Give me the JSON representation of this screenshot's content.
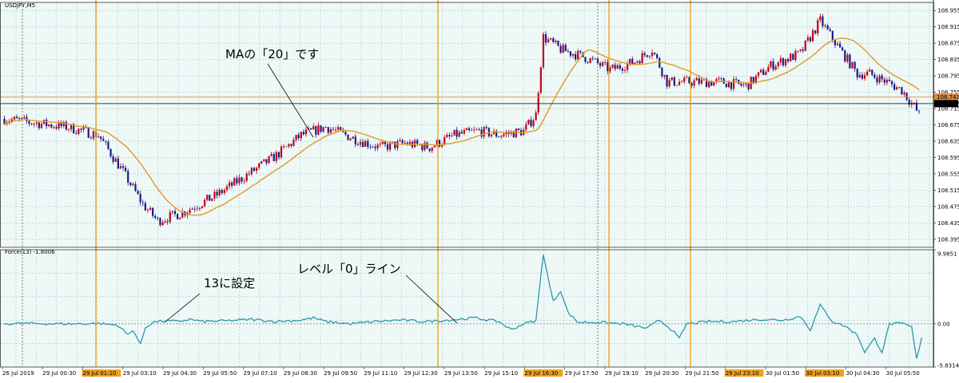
{
  "chart_data": {
    "type": "candlestick",
    "symbol_label": "USDJPY,M5",
    "indicator_label": "Force(13) -1.8006",
    "price_axis": {
      "range": [
        108.375,
        108.975
      ],
      "ticks": [
        "108.955",
        "108.915",
        "108.875",
        "108.835",
        "108.795",
        "108.755",
        "108.715",
        "108.675",
        "108.635",
        "108.595",
        "108.555",
        "108.515",
        "108.475",
        "108.435",
        "108.395"
      ]
    },
    "price_tags": [
      {
        "label": "108.743",
        "value": 108.743,
        "color": "#e08a3c"
      },
      {
        "label": "108.727",
        "value": 108.727,
        "color": "#000000"
      }
    ],
    "indicator_axis": {
      "range": [
        -5.8314,
        9.9851
      ],
      "ticks": [
        {
          "label": "9.9851",
          "value": 9.9851
        },
        {
          "label": "0.00",
          "value": 0
        },
        {
          "label": "-5.8314",
          "value": -5.8314
        }
      ]
    },
    "time_axis": {
      "labels": [
        "26 Jul 2019",
        "29 Jul 00:30",
        "29 Jul 01:10",
        "29 Jul 03:10",
        "29 Jul 04:30",
        "29 Jul 05:50",
        "29 Jul 07:10",
        "29 Jul 08:30",
        "29 Jul 09:50",
        "29 Jul 11:10",
        "29 Jul 12:30",
        "29 Jul 13:50",
        "29 Jul 15:10",
        "29 Jul 16:30",
        "29 Jul 17:50",
        "29 Jul 19:10",
        "29 Jul 20:30",
        "29 Jul 21:50",
        "29 Jul 23:10",
        "30 Jul 01:50",
        "30 Jul 03:10",
        "30 Jul 04:30",
        "30 Jul 05:50"
      ],
      "highlighted": [
        2,
        13,
        18,
        20
      ]
    },
    "ma_label": "MA",
    "series": [
      {
        "name": "USDJPY",
        "type": "candle",
        "color_up": "#c00018",
        "color_down": "#1a1a8c",
        "key_points": [
          [
            0,
            108.69
          ],
          [
            12,
            108.68
          ],
          [
            25,
            108.67
          ],
          [
            38,
            108.65
          ],
          [
            48,
            108.56
          ],
          [
            56,
            108.48
          ],
          [
            62,
            108.44
          ],
          [
            72,
            108.46
          ],
          [
            85,
            108.5
          ],
          [
            100,
            108.56
          ],
          [
            110,
            108.6
          ],
          [
            120,
            108.65
          ],
          [
            130,
            108.67
          ],
          [
            142,
            108.64
          ],
          [
            152,
            108.62
          ],
          [
            162,
            108.63
          ],
          [
            172,
            108.62
          ],
          [
            182,
            108.65
          ],
          [
            192,
            108.66
          ],
          [
            200,
            108.65
          ],
          [
            210,
            108.66
          ],
          [
            215,
            108.7
          ],
          [
            218,
            108.89
          ],
          [
            225,
            108.86
          ],
          [
            235,
            108.84
          ],
          [
            245,
            108.81
          ],
          [
            255,
            108.83
          ],
          [
            262,
            108.86
          ],
          [
            268,
            108.78
          ],
          [
            278,
            108.78
          ],
          [
            290,
            108.78
          ],
          [
            300,
            108.77
          ],
          [
            310,
            108.82
          ],
          [
            322,
            108.85
          ],
          [
            330,
            108.93
          ],
          [
            338,
            108.86
          ],
          [
            345,
            108.8
          ],
          [
            350,
            108.8
          ],
          [
            357,
            108.78
          ],
          [
            363,
            108.76
          ],
          [
            368,
            108.72
          ],
          [
            370,
            108.7
          ]
        ]
      },
      {
        "name": "MA(20)",
        "type": "line",
        "color": "#e0a030"
      },
      {
        "name": "Force(13)",
        "type": "line",
        "color": "#2a98b0",
        "key_points": [
          [
            0,
            0.0
          ],
          [
            10,
            0.05
          ],
          [
            20,
            0.0
          ],
          [
            30,
            0.0
          ],
          [
            38,
            0.05
          ],
          [
            46,
            -0.2
          ],
          [
            50,
            -1.5
          ],
          [
            52,
            -0.8
          ],
          [
            55,
            -2.8
          ],
          [
            57,
            -0.5
          ],
          [
            60,
            0.2
          ],
          [
            65,
            0.4
          ],
          [
            70,
            0.3
          ],
          [
            75,
            0.6
          ],
          [
            80,
            0.3
          ],
          [
            90,
            0.4
          ],
          [
            100,
            0.6
          ],
          [
            110,
            0.3
          ],
          [
            120,
            0.5
          ],
          [
            125,
            0.8
          ],
          [
            130,
            0.3
          ],
          [
            140,
            0.0
          ],
          [
            150,
            0.3
          ],
          [
            160,
            0.5
          ],
          [
            170,
            0.3
          ],
          [
            180,
            0.5
          ],
          [
            190,
            0.8
          ],
          [
            200,
            0.3
          ],
          [
            205,
            -0.8
          ],
          [
            210,
            0.0
          ],
          [
            215,
            0.4
          ],
          [
            218,
            9.5
          ],
          [
            220,
            6.0
          ],
          [
            222,
            3.0
          ],
          [
            225,
            4.5
          ],
          [
            228,
            1.5
          ],
          [
            232,
            0.2
          ],
          [
            240,
            0.2
          ],
          [
            250,
            0.0
          ],
          [
            260,
            -0.6
          ],
          [
            265,
            0.5
          ],
          [
            270,
            -0.8
          ],
          [
            273,
            -2.0
          ],
          [
            276,
            0.0
          ],
          [
            285,
            0.3
          ],
          [
            295,
            0.3
          ],
          [
            305,
            0.6
          ],
          [
            315,
            0.5
          ],
          [
            322,
            1.0
          ],
          [
            326,
            -0.8
          ],
          [
            330,
            2.5
          ],
          [
            335,
            0.3
          ],
          [
            340,
            -0.3
          ],
          [
            345,
            -1.5
          ],
          [
            348,
            -3.8
          ],
          [
            352,
            -2.0
          ],
          [
            355,
            -3.8
          ],
          [
            358,
            0.0
          ],
          [
            364,
            0.0
          ],
          [
            367,
            -0.5
          ],
          [
            369,
            -4.8
          ],
          [
            371,
            -1.8
          ]
        ]
      }
    ],
    "annotations": [
      {
        "text": "MAの「20」です"
      },
      {
        "text": "13に設定"
      },
      {
        "text": "レベル「0」ライン"
      }
    ]
  }
}
